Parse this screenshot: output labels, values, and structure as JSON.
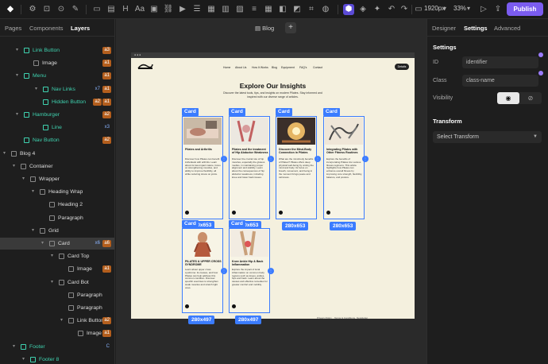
{
  "toolbar": {
    "viewport": "1920px",
    "zoom": "33%",
    "publish": "Publish"
  },
  "left_panel": {
    "tabs": [
      "Pages",
      "Components",
      "Layers"
    ],
    "active_tab": "Layers",
    "tree": [
      {
        "label": "Link Button",
        "badge": "a3",
        "badge_style": "orange",
        "green": true
      },
      {
        "label": "Image",
        "badge": "a1",
        "badge_style": "orange",
        "green": false
      },
      {
        "label": "Menu",
        "badge": "a1",
        "badge_style": "orange",
        "green": true
      },
      {
        "label": "Nav Links",
        "badge": "a1",
        "badge2": "x7",
        "badge_style": "orange",
        "green": true
      },
      {
        "label": "Hidden Button",
        "badge": "a1",
        "badge2": "a2",
        "badge_style": "orange",
        "green": true
      },
      {
        "label": "Hamburger",
        "badge": "a2",
        "badge_style": "orange",
        "green": true
      },
      {
        "label": "Line",
        "badge": "x3",
        "badge_style": "blue",
        "green": true
      },
      {
        "label": "Nav Button",
        "badge": "a2",
        "badge_style": "orange",
        "green": true
      },
      {
        "label": "Blog 4",
        "badge": "",
        "badge_style": "",
        "green": false
      },
      {
        "label": "Container",
        "badge": "",
        "badge_style": "",
        "green": false
      },
      {
        "label": "Wrapper",
        "badge": "",
        "badge_style": "",
        "green": false
      },
      {
        "label": "Heading Wrap",
        "badge": "",
        "badge_style": "",
        "green": false
      },
      {
        "label": "Heading 2",
        "badge": "",
        "badge_style": "",
        "green": false
      },
      {
        "label": "Paragraph",
        "badge": "",
        "badge_style": "",
        "green": false
      },
      {
        "label": "Grid",
        "badge": "",
        "badge_style": "",
        "green": false
      },
      {
        "label": "Card",
        "badge": "a6",
        "badge2": "x6",
        "badge_style": "orange",
        "green": false
      },
      {
        "label": "Card Top",
        "badge": "",
        "badge_style": "",
        "green": false
      },
      {
        "label": "Image",
        "badge": "a1",
        "badge_style": "orange",
        "green": false
      },
      {
        "label": "Card Bot",
        "badge": "",
        "badge_style": "",
        "green": false
      },
      {
        "label": "Paragraph",
        "badge": "",
        "badge_style": "",
        "green": false
      },
      {
        "label": "Paragraph",
        "badge": "",
        "badge_style": "",
        "green": false
      },
      {
        "label": "Link Button",
        "badge": "a2",
        "badge_style": "orange",
        "green": false
      },
      {
        "label": "Image",
        "badge": "a1",
        "badge_style": "orange",
        "green": false
      },
      {
        "label": "Footer",
        "badge": "C",
        "badge_style": "blue",
        "green": true
      },
      {
        "label": "Footer 8",
        "badge": "",
        "badge_style": "",
        "green": true
      }
    ]
  },
  "canvas": {
    "tab_label": "Blog",
    "page": {
      "nav_links": [
        "Home",
        "About Us",
        "How It Works",
        "Blog",
        "Equipment",
        "FAQ's",
        "Contact"
      ],
      "nav_button": "Details",
      "title": "Explore Our Insights",
      "subtitle": "Discover the latest tools, tips, and insights on modern Pilates. Stay informed and inspired with our diverse range of articles.",
      "cards": [
        {
          "title": "Pilates and Arthritis",
          "body": "Discover how Pilates can benefit individuals with arthritis. Learn about its low-impact nature, focus on strengthening muscles, and ability to improve flexibility, all while reducing stress on joints."
        },
        {
          "title": "Pilates and the treatment of Hip Abductor Weakness",
          "body": "Discover the crucial role of hip muscles, especially the gluteus medius, in maintaining proper alignment and stability. Learn about the consequences of hip abductor weakness, including knee and lower back issues."
        },
        {
          "title": "Discover the Mind-Body Connection in Pilates",
          "body": "What are the mind-body benefits of Pilates? Pilates offers deep physical well-being by uniting the mind and body. Its focus on breath, movement, and being in the moment brings peace and calmness."
        },
        {
          "title": "Integrating Pilates with Other Fitness Routines",
          "body": "Explore the benefits of incorporating Pilates into various fitness regimens. This article highlights how Pilates can enhance overall fitness by improving core strength, flexibility, balance, and posture."
        },
        {
          "title": "PILATES & UPPER CROSS SYNDROME",
          "body": "Learn about upper cross syndrome: its causes, and how Pilates can help address this common condition. Discover specific exercises to strengthen weak muscles and stretch tight ones."
        },
        {
          "title": "Knee Ankle Hip & Back Inflammation",
          "body": "Explore the impact of local inflammation on common body regions such as knees, ankles, hips and back. Learn about the causes and effective remedies for greater comfort and mobility."
        }
      ],
      "card_tags": [
        "Card",
        "Card",
        "Card",
        "Card",
        "Card",
        "Card"
      ],
      "dims": [
        "280x653",
        "280x653",
        "280x653",
        "280x653",
        "280x497",
        "280x497"
      ],
      "footer_links": [
        "Privacy Policy",
        "Terms & Conditions",
        "Newsletter"
      ]
    }
  },
  "right_panel": {
    "tabs": [
      "Designer",
      "Settings",
      "Advanced"
    ],
    "active_tab": "Settings",
    "settings_heading": "Settings",
    "id_label": "ID",
    "id_placeholder": "identifier",
    "class_label": "Class",
    "class_placeholder": "class-name",
    "visibility_label": "Visibility",
    "transform_heading": "Transform",
    "transform_select": "Select Transform"
  },
  "colors": {
    "accent": "#3b7cff",
    "publish": "#7b5cf0",
    "layer_green": "#3fd3b0",
    "page_bg": "#f4f0de"
  }
}
